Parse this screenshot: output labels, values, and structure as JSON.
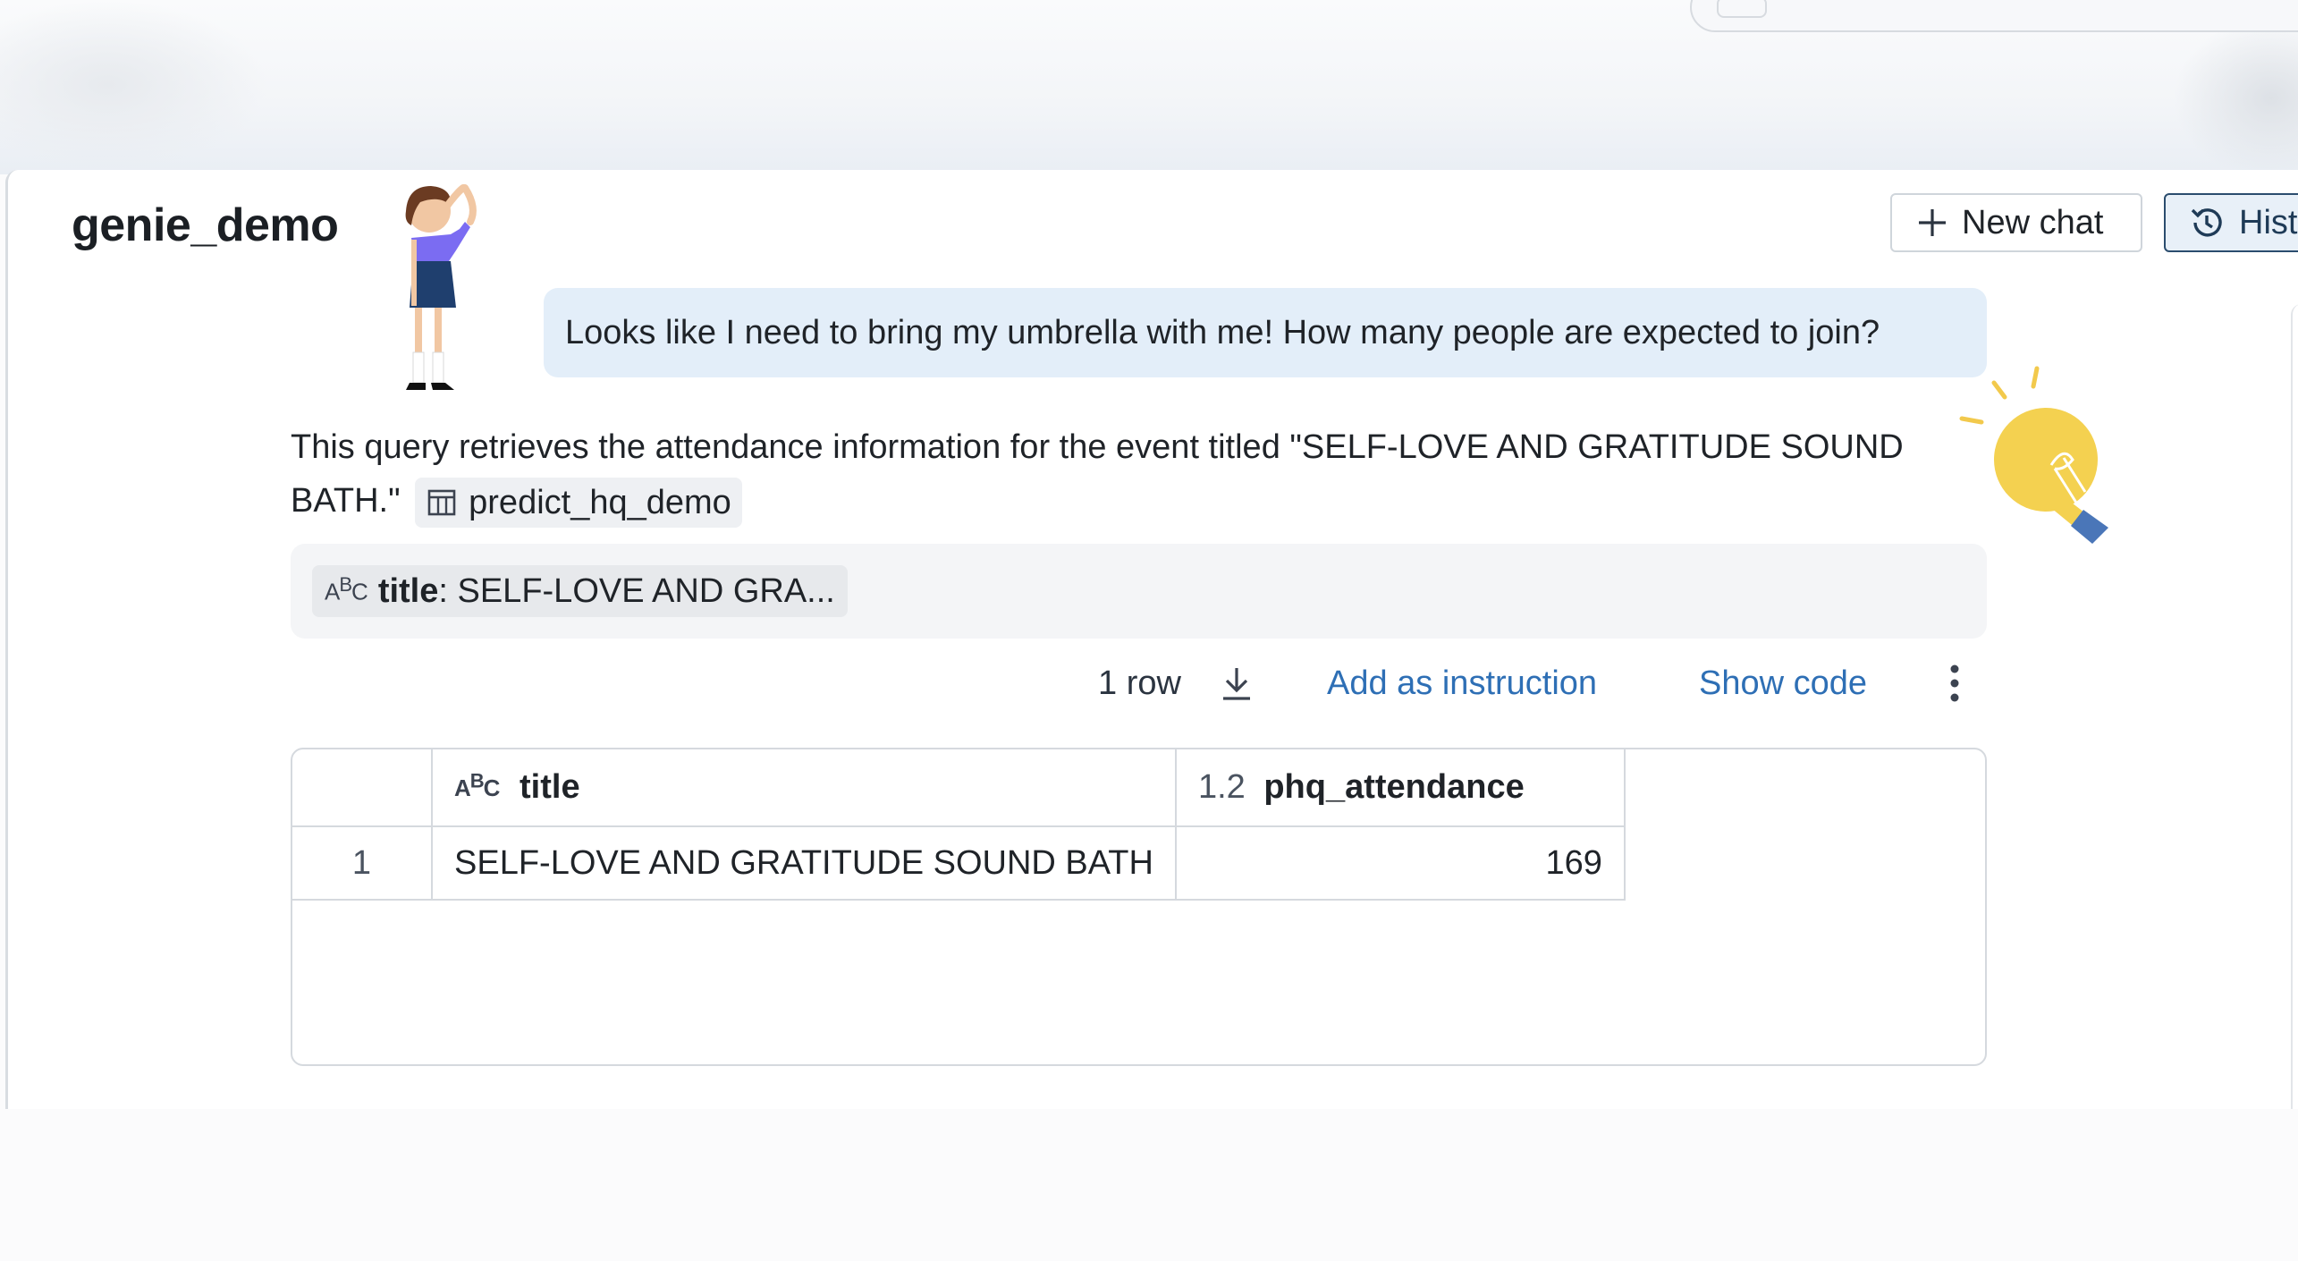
{
  "app": {
    "title": "genie_demo"
  },
  "header": {
    "new_chat_label": "New chat",
    "history_label": "History"
  },
  "conversation": {
    "user_message": "Looks like I need to bring my umbrella with me! How many people are expected to join?",
    "answer_text": "This query retrieves the attendance information for the event titled \"SELF-LOVE AND GRATITUDE SOUND BATH.\"",
    "source_table": "predict_hq_demo"
  },
  "filter": {
    "field": "title",
    "value": ": SELF-LOVE AND GRA..."
  },
  "result_toolbar": {
    "row_count": "1 row",
    "add_instruction_label": "Add as instruction",
    "show_code_label": "Show code"
  },
  "result_table": {
    "columns": [
      {
        "name": "title",
        "type_marker": "ABC"
      },
      {
        "name": "phq_attendance",
        "type_marker": "1.2"
      }
    ],
    "rows": [
      {
        "index": "1",
        "title": "SELF-LOVE AND GRATITUDE SOUND BATH",
        "phq_attendance": "169"
      }
    ]
  },
  "icons": {
    "new_chat": "plus-icon",
    "history": "history-icon",
    "table": "table-icon",
    "download": "download-icon",
    "more": "kebab-menu-icon",
    "string_type": "abc-type-icon"
  },
  "colors": {
    "user_bubble": "#e3eef9",
    "link": "#2e6fb5",
    "history_active_border": "#2b4d6e"
  }
}
